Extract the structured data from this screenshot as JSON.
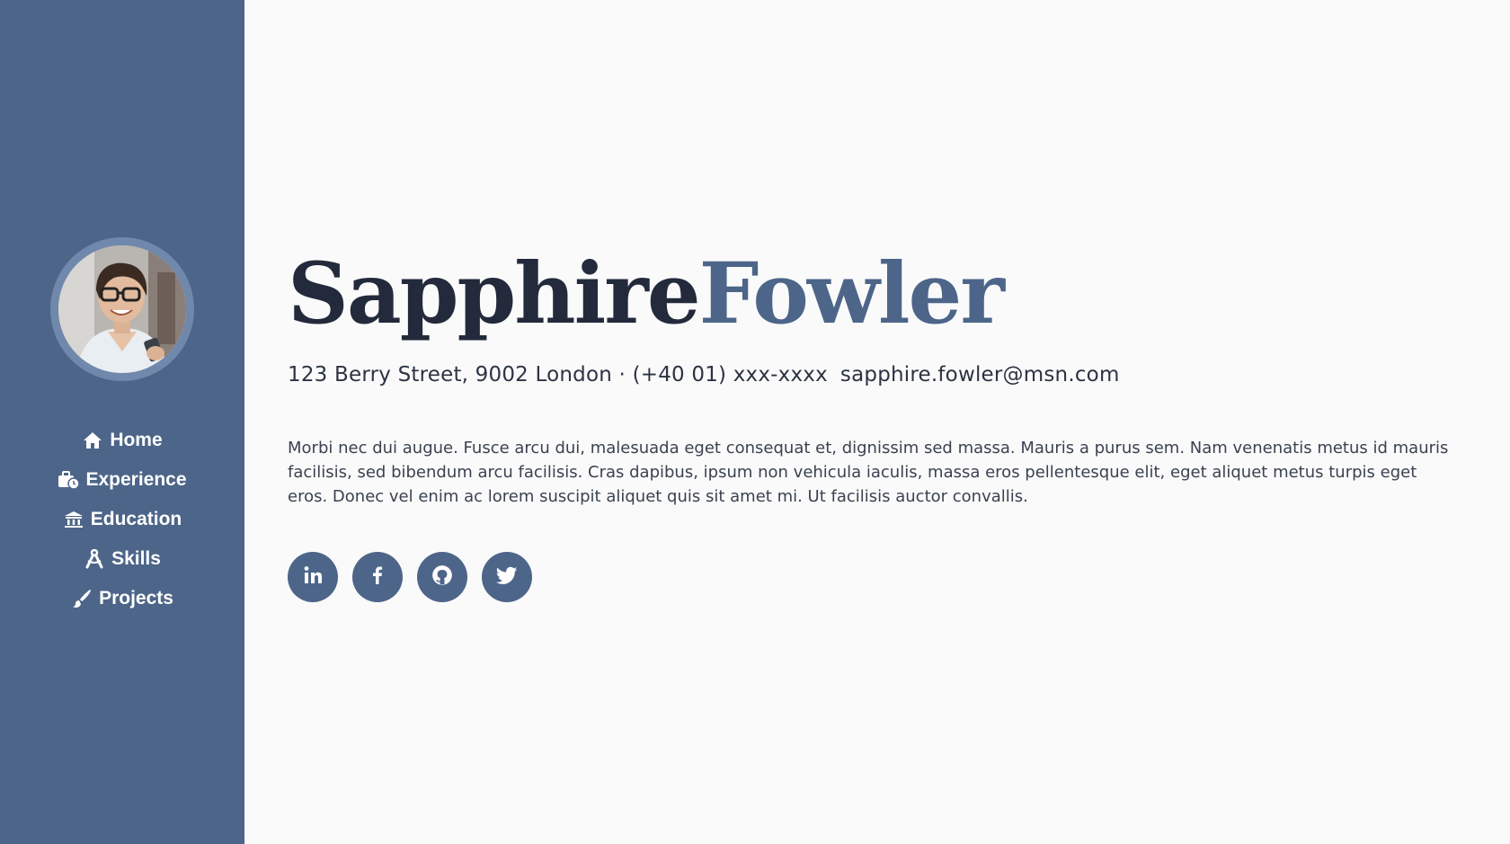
{
  "profile": {
    "first_name": "Sapphire",
    "last_name": "Fowler",
    "address": "123 Berry Street, 9002 London · (+40 01) xxx-xxxx",
    "email": "sapphire.fowler@msn.com",
    "bio": "Morbi nec dui augue. Fusce arcu dui, malesuada eget consequat et, dignissim sed massa. Mauris a purus sem. Nam venenatis metus id mauris facilisis, sed bibendum arcu facilisis. Cras dapibus, ipsum non vehicula iaculis, massa eros pellentesque elit, eget aliquet metus turpis eget eros. Donec vel enim ac lorem suscipit aliquet quis sit amet mi. Ut facilisis auctor convallis."
  },
  "nav": {
    "items": [
      {
        "label": "Home",
        "icon": "home-icon"
      },
      {
        "label": "Experience",
        "icon": "briefcase-clock-icon"
      },
      {
        "label": "Education",
        "icon": "university-icon"
      },
      {
        "label": "Skills",
        "icon": "compass-drafting-icon"
      },
      {
        "label": "Projects",
        "icon": "paint-brush-icon"
      }
    ]
  },
  "socials": [
    {
      "icon": "linkedin-icon"
    },
    {
      "icon": "facebook-icon"
    },
    {
      "icon": "github-icon"
    },
    {
      "icon": "twitter-icon"
    }
  ],
  "colors": {
    "sidebar": "#4d6589",
    "accent": "#4d6589",
    "name_dark": "#232a3b",
    "background": "#fafafa"
  }
}
